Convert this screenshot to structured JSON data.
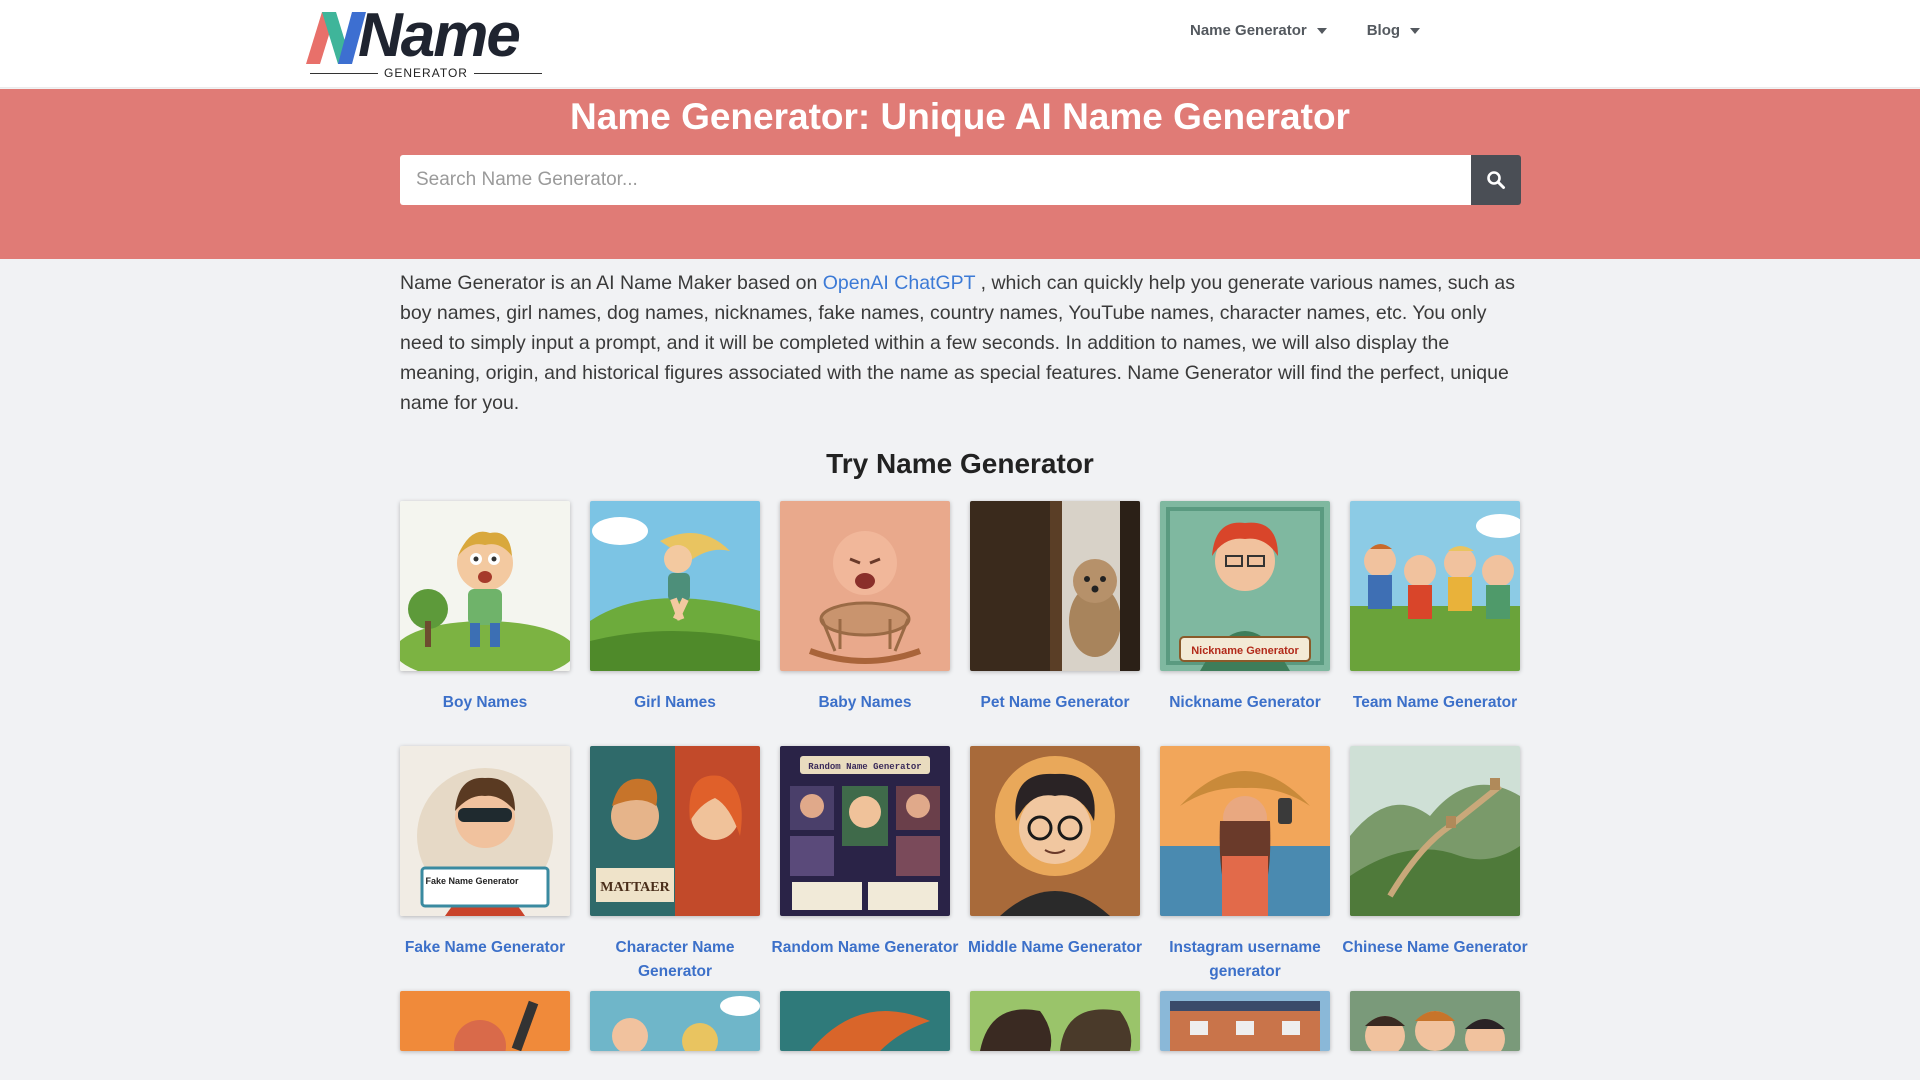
{
  "logo": {
    "wordmark": "Name",
    "subtitle": "GENERATOR"
  },
  "nav": [
    {
      "label": "Name Generator"
    },
    {
      "label": "Blog"
    }
  ],
  "hero": {
    "title": "Name Generator: Unique AI Name Generator",
    "search_placeholder": "Search Name Generator..."
  },
  "intro": {
    "before_link": "Name Generator is an AI Name Maker based on ",
    "link": "OpenAI ChatGPT",
    "after_link": " , which can quickly help you generate various names, such as boy names, girl names, dog names, nicknames, fake names, country names, YouTube names, character names, etc. You only need to simply input a prompt, and it will be completed within a few seconds. In addition to names, we will also display the meaning, origin, and historical figures associated with the name as special features. Name Generator will find the perfect, unique name for you."
  },
  "section_title": "Try Name Generator",
  "cards": [
    {
      "label": "Boy Names"
    },
    {
      "label": "Girl Names"
    },
    {
      "label": "Baby Names"
    },
    {
      "label": "Pet Name Generator"
    },
    {
      "label": "Nickname Generator",
      "image_text": "Nickname Generator"
    },
    {
      "label": "Team Name Generator"
    },
    {
      "label": "Fake Name Generator",
      "image_text": "Fake Name Generator"
    },
    {
      "label": "Character Name Generator",
      "image_text": "MATTAER"
    },
    {
      "label": "Random Name Generator",
      "image_text": "Random Name Generator"
    },
    {
      "label": "Middle Name Generator"
    },
    {
      "label": "Instagram username generator"
    },
    {
      "label": "Chinese Name Generator"
    }
  ],
  "colors": {
    "hero": "#e07b76",
    "link": "#3c70c9",
    "search_button": "#4a4e55"
  }
}
